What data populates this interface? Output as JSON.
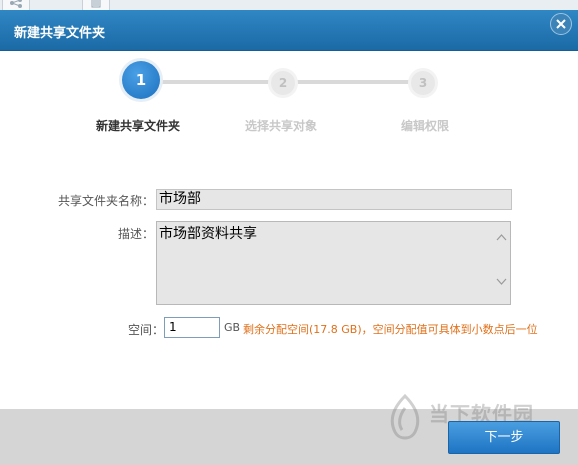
{
  "dialog": {
    "title": "新建共享文件夹"
  },
  "wizard": {
    "steps": [
      {
        "number": "1",
        "label": "新建共享文件夹",
        "state": "active"
      },
      {
        "number": "2",
        "label": "选择共享对象",
        "state": "inactive"
      },
      {
        "number": "3",
        "label": "编辑权限",
        "state": "inactive"
      }
    ]
  },
  "form": {
    "name_label": "共享文件夹名称：",
    "name_value": "市场部",
    "desc_label": "描述：",
    "desc_value": "市场部资料共享",
    "space_label": "空间：",
    "space_value": "1",
    "space_unit": "GB",
    "space_hint": "剩余分配空间(17.8 GB)，空间分配值可具体到小数点后一位"
  },
  "footer": {
    "next_label": "下一步"
  },
  "watermark": {
    "text": "当下软件园",
    "url": "downxia.com"
  },
  "colors": {
    "titlebar": "#1f70ab",
    "accent": "#1c70bf",
    "hint": "#e0701b"
  },
  "icons": {
    "close": "close-icon",
    "scroll_up": "chevron-up-icon",
    "scroll_down": "chevron-down-icon"
  }
}
